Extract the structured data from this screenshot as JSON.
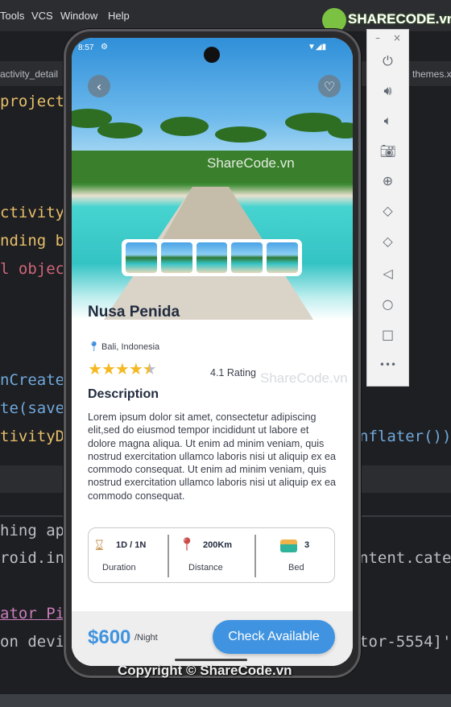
{
  "ide": {
    "menu": [
      "Tools",
      "VCS",
      "Window",
      "Help"
    ],
    "tabs": {
      "left": "activity_detail",
      "right": "themes.x"
    },
    "code_left": [
      {
        "text": "project",
        "color": "#e8bf6a"
      },
      {
        "text": "ctivity",
        "color": "#e8bf6a"
      },
      {
        "text": "nding b",
        "color": "#e8bf6a"
      },
      {
        "text": "l objec",
        "color": "#cf6679"
      },
      {
        "text": "nCreate",
        "color": "#6fa8dc"
      },
      {
        "text": "te(save",
        "color": "#6fa8dc"
      },
      {
        "text": "tivityD",
        "color": "#e8bf6a"
      }
    ],
    "code_right": "nflater())",
    "console_left": [
      "hing ap",
      "roid.in",
      "ator Pi",
      "on devi"
    ],
    "console_right": [
      "ntent.cate",
      "tor-5554]'"
    ]
  },
  "watermark": {
    "logo": "SHARECODE.vn",
    "overlay": "ShareCode.vn",
    "copyright": "Copyright © ShareCode.vn"
  },
  "emulator": {
    "window_controls": [
      "–",
      "×"
    ],
    "toolbar": [
      "power-icon",
      "volume-up-icon",
      "volume-down-icon",
      "camera-icon",
      "zoom-icon",
      "rotate-left-icon",
      "rotate-right-icon",
      "back-icon",
      "home-icon",
      "overview-icon",
      "more-icon"
    ]
  },
  "app": {
    "status_bar": {
      "time": "8:57"
    },
    "title": "Nusa Penida",
    "location": "Bali, Indonesia",
    "rating": {
      "value": 4.1,
      "label": "4.1 Rating",
      "max": 5
    },
    "description_heading": "Description",
    "description": "Lorem ipsum dolor sit amet, consectetur adipiscing  elit,sed do eiusmod tempor incididunt ut labore et  dolore magna aliqua. Ut enim ad minim veniam, quis  nostrud exercitation ullamco laboris nisi ut aliquip  ex ea commodo consequat. Ut enim ad minim  veniam, quis nostrud exercitation ullamco laboris  nisi ut aliquip ex ea commodo consequat.",
    "stats": [
      {
        "value": "1D / 1N",
        "label": "Duration",
        "icon": "hourglass-icon"
      },
      {
        "value": "200Km",
        "label": "Distance",
        "icon": "route-pin-icon"
      },
      {
        "value": "3",
        "label": "Bed",
        "icon": "bed-icon"
      }
    ],
    "price": "$600",
    "price_unit": "/Night",
    "cta": "Check Available",
    "colors": {
      "accent": "#3f93e0",
      "star": "#f5b821",
      "title": "#222c3f"
    }
  }
}
